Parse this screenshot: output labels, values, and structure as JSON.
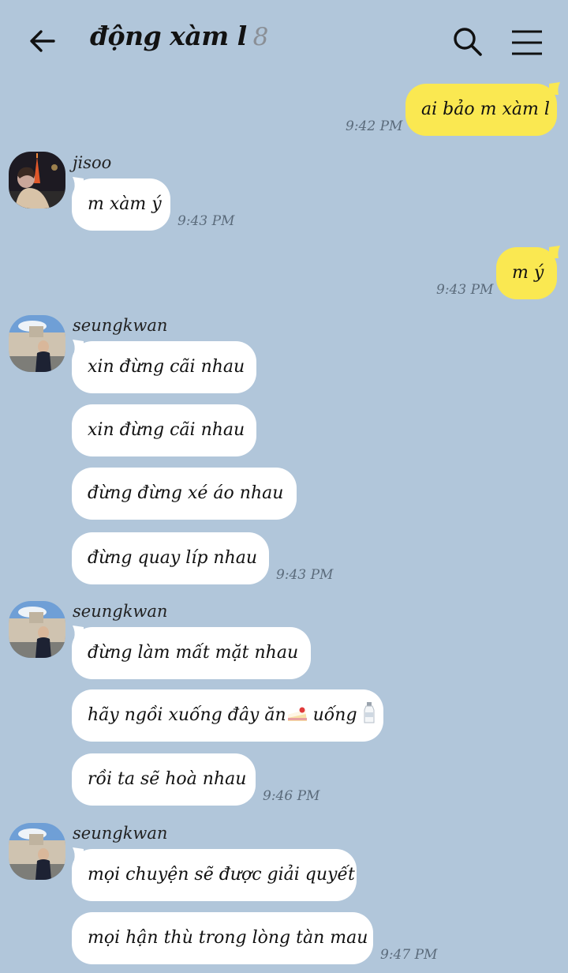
{
  "header": {
    "title": "động xàm l",
    "member_count": "8"
  },
  "messages": {
    "m1": {
      "text": "ai bảo m xàm l",
      "time": "9:42 PM"
    },
    "m2": {
      "sender": "jisoo",
      "text": "m xàm ý",
      "time": "9:43 PM"
    },
    "m3": {
      "text": "m ý",
      "time": "9:43 PM"
    },
    "g1": {
      "sender": "seungkwan",
      "lines": [
        "xin đừng cãi nhau",
        "xin đừng cãi nhau",
        "đừng đừng xé áo nhau",
        "đừng quay líp nhau"
      ],
      "time": "9:43 PM"
    },
    "g2": {
      "sender": "seungkwan",
      "lines": [
        "đừng làm mất mặt nhau",
        "hãy ngồi xuống đây ăn",
        "uống",
        "rồi ta sẽ hoà nhau"
      ],
      "time": "9:46 PM"
    },
    "g3": {
      "sender": "seungkwan",
      "lines": [
        "mọi chuyện sẽ được giải quyết",
        "mọi hận thù trong lòng tàn mau"
      ],
      "time": "9:47 PM"
    }
  },
  "icons": [
    "back-arrow-icon",
    "search-icon",
    "menu-icon",
    "cake-emoji-icon",
    "milk-bottle-emoji-icon"
  ],
  "colors": {
    "background": "#b1c6da",
    "my_bubble": "#fae851",
    "other_bubble": "#ffffff"
  }
}
